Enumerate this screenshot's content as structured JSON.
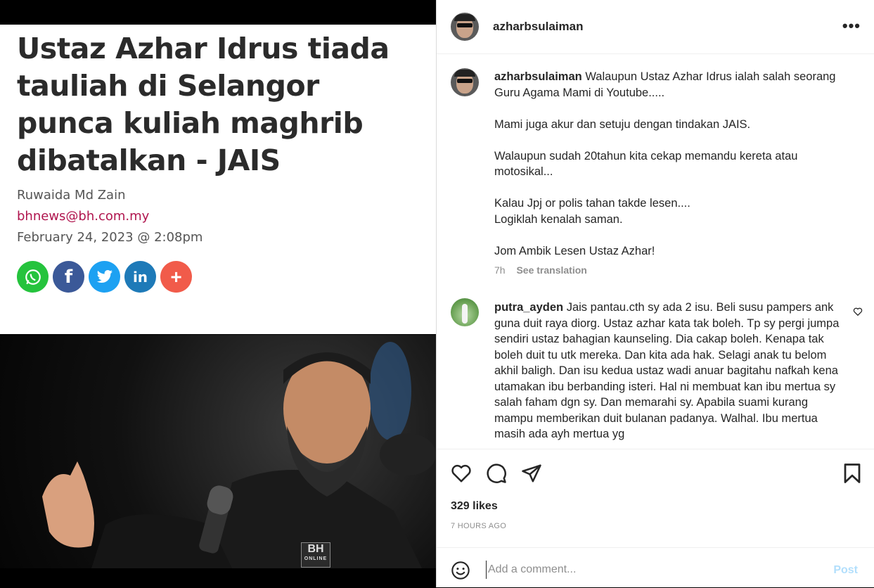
{
  "article": {
    "headline": "Ustaz Azhar Idrus tiada tauliah di Selangor punca kuliah maghrib dibatalkan - JAIS",
    "author": "Ruwaida Md Zain",
    "email": "bhnews@bh.com.my",
    "date": "February 24, 2023 @ 2:08pm",
    "share_buttons": [
      {
        "name": "whatsapp",
        "color": "#25c33d",
        "glyph": "✆"
      },
      {
        "name": "facebook",
        "color": "#3b5998",
        "glyph": "f"
      },
      {
        "name": "twitter",
        "color": "#1da1f2",
        "glyph": "🐦"
      },
      {
        "name": "linkedin",
        "color": "#1e7ab8",
        "glyph": "in"
      },
      {
        "name": "more",
        "color": "#f15b4a",
        "glyph": "+"
      }
    ],
    "photo_logo": "BH",
    "photo_logo_sub": "ONLINE"
  },
  "post": {
    "username": "azharbsulaiman",
    "caption_username": "azharbsulaiman",
    "caption_lines": [
      "Walaupun Ustaz Azhar Idrus ialah salah seorang Guru Agama Mami di Youtube.....",
      "Mami juga akur dan setuju dengan tindakan JAIS.",
      "Walaupun sudah 20tahun kita cekap memandu kereta atau motosikal...",
      "Kalau Jpj or polis tahan takde lesen....\nLogiklah kenalah saman.",
      "Jom Ambik Lesen Ustaz Azhar!"
    ],
    "caption_time": "7h",
    "see_translation": "See translation",
    "comment": {
      "username": "putra_ayden",
      "text": "Jais pantau.cth sy ada 2 isu. Beli susu pampers ank guna duit raya diorg. Ustaz azhar kata tak boleh. Tp sy pergi jumpa sendiri ustaz bahagian kaunseling. Dia cakap boleh. Kenapa tak boleh duit tu utk mereka. Dan kita ada hak. Selagi anak tu belom akhil baligh. Dan isu kedua ustaz wadi anuar bagitahu nafkah kena utamakan ibu berbanding isteri. Hal ni membuat kan ibu mertua sy salah faham dgn sy. Dan memarahi sy. Apabila suami kurang mampu memberikan duit bulanan padanya. Walhal. Ibu mertua masih ada ayh mertua yg"
    },
    "likes": "329 likes",
    "time_ago": "7 HOURS AGO",
    "comment_placeholder": "Add a comment...",
    "post_button": "Post"
  }
}
